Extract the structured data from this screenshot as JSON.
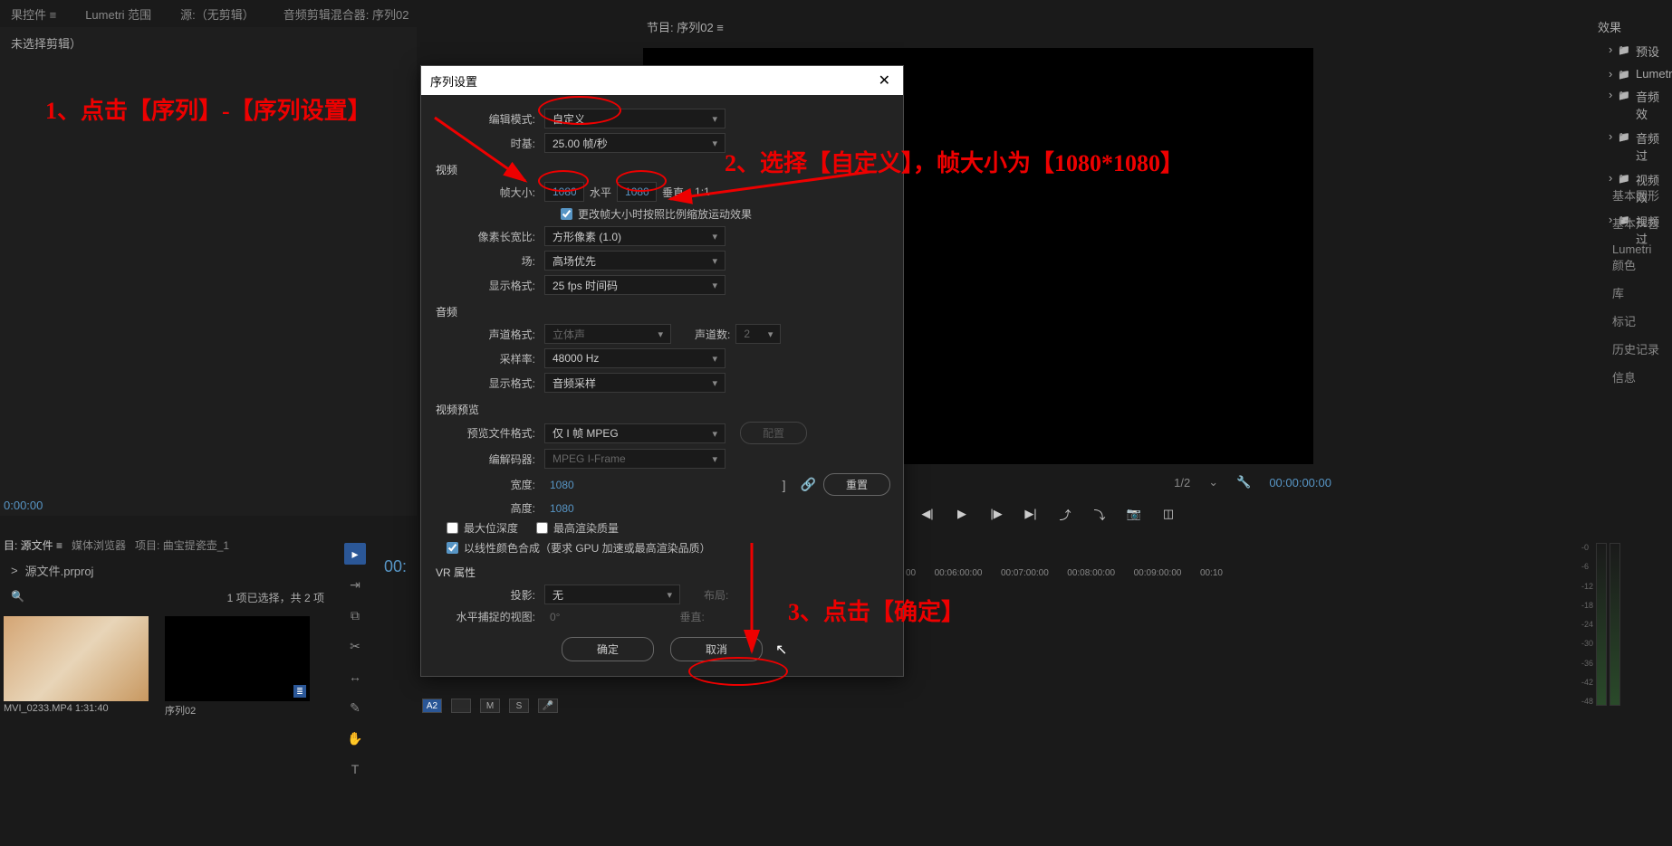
{
  "top_tabs": {
    "t1": "果控件 ≡",
    "t2": "Lumetri 范围",
    "t3": "源:（无剪辑）",
    "t4": "音频剪辑混合器: 序列02"
  },
  "source": {
    "no_clip": "未选择剪辑）",
    "timecode": "0:00:00"
  },
  "program": {
    "title": "节目: 序列02 ≡",
    "zoom": "1/2",
    "chev": "⌄",
    "wrench": "🔧",
    "timecode": "00:00:00:00"
  },
  "right": {
    "hdr": "效果",
    "items": [
      "预设",
      "Lumetr",
      "音频效",
      "音频过",
      "视频效",
      "视频过"
    ],
    "collapsed": [
      "基本图形",
      "基本声音",
      "Lumetri 颜色",
      "库",
      "标记",
      "历史记录",
      "信息"
    ]
  },
  "project": {
    "tabs": {
      "t1": "目: 源文件 ≡",
      "t2": "媒体浏览器",
      "t3": "项目: 曲宝提瓷壶_1"
    },
    "sub": "源文件.prproj",
    "chev": ">",
    "search_icon": "🔍",
    "info": "1 项已选择，共 2 项",
    "thumb1": "MVI_0233.MP4    1:31:40",
    "thumb2": "序列02"
  },
  "timeline": {
    "timecode": "00:",
    "ruler": [
      "00",
      "00:06:00:00",
      "00:07:00:00",
      "00:08:00:00",
      "00:09:00:00",
      "00:10"
    ],
    "bottom": [
      "A2",
      "",
      "M",
      "S",
      "🎤"
    ]
  },
  "meter_scale": [
    "-0",
    "-6",
    "-12",
    "-18",
    "-24",
    "-30",
    "-36",
    "-42",
    "-48"
  ],
  "modal": {
    "title": "序列设置",
    "edit_mode": {
      "lbl": "编辑模式:",
      "val": "自定义"
    },
    "timebase": {
      "lbl": "时基:",
      "val": "25.00 帧/秒"
    },
    "video_hdr": "视频",
    "frame_size": {
      "lbl": "帧大小:",
      "w": "1080",
      "hlbl": "水平",
      "h": "1080",
      "vlbl": "垂直",
      "ratio": "1:1"
    },
    "scale_chk": "更改帧大小时按照比例缩放运动效果",
    "pixel_ar": {
      "lbl": "像素长宽比:",
      "val": "方形像素 (1.0)"
    },
    "fields": {
      "lbl": "场:",
      "val": "高场优先"
    },
    "vdisp": {
      "lbl": "显示格式:",
      "val": "25 fps 时间码"
    },
    "audio_hdr": "音频",
    "achan": {
      "lbl": "声道格式:",
      "val": "立体声",
      "chn_lbl": "声道数:",
      "chn_val": "2"
    },
    "sample": {
      "lbl": "采样率:",
      "val": "48000 Hz"
    },
    "adisp": {
      "lbl": "显示格式:",
      "val": "音频采样"
    },
    "preview_hdr": "视频预览",
    "pfile": {
      "lbl": "预览文件格式:",
      "val": "仅 I 帧 MPEG",
      "cfg": "配置"
    },
    "codec": {
      "lbl": "编解码器:",
      "val": "MPEG I-Frame"
    },
    "pw": {
      "lbl": "宽度:",
      "val": "1080"
    },
    "ph": {
      "lbl": "高度:",
      "val": "1080"
    },
    "reset": "重置",
    "max_depth": "最大位深度",
    "max_qual": "最高渲染质量",
    "linear": "以线性颜色合成（要求 GPU 加速或最高渲染品质）",
    "vr_hdr": "VR 属性",
    "proj": {
      "lbl": "投影:",
      "val": "无",
      "layout_lbl": "布局:"
    },
    "hcap": {
      "lbl": "水平捕捉的视图:",
      "val": "0°",
      "vcap_lbl": "垂直:"
    },
    "ok": "确定",
    "cancel": "取消"
  },
  "anno": {
    "a1": "1、点击【序列】-【序列设置】",
    "a2": "2、选择【自定义】，帧大小为【1080*1080】",
    "a3": "3、点击【确定】"
  }
}
